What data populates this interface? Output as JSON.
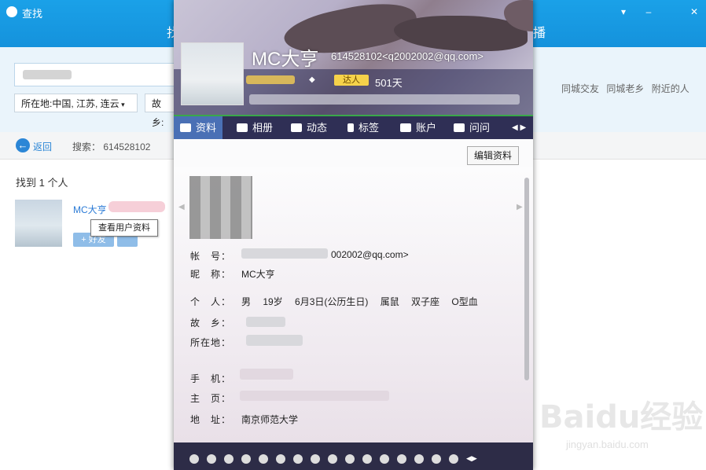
{
  "window": {
    "title": "查找",
    "header_partial": "找",
    "header_partial_right": "播"
  },
  "search": {
    "location_filter": "所在地:中国, 江苏, 连云",
    "hometown_filter": "故乡:"
  },
  "side_links": [
    "同城交友",
    "同城老乡",
    "附近的人"
  ],
  "nav": {
    "back_label": "返回",
    "search_label": "搜索：",
    "search_value": "614528102"
  },
  "results": {
    "count_label": "找到 1 个人",
    "items": [
      {
        "name": "MC大亨",
        "add_label": "+ 好友",
        "tooltip": "查看用户资料"
      }
    ]
  },
  "profile": {
    "name": "MC大亨",
    "qq_email": "614528102<q2002002@qq.com>",
    "badge": "达人",
    "days": "501天",
    "tabs": [
      "资料",
      "相册",
      "动态",
      "标签",
      "账户",
      "问问"
    ],
    "edit_button": "编辑资料",
    "fields": [
      {
        "label": "帐　号：",
        "value": "002002@qq.com>"
      },
      {
        "label": "昵　称：",
        "value": "MC大亨"
      },
      {
        "label": "个　人：",
        "value": "男　 19岁　 6月3日(公历生日)　 属鼠　 双子座　 O型血"
      },
      {
        "label": "故　乡：",
        "value": ""
      },
      {
        "label": "所在地：",
        "value": ""
      },
      {
        "label": "手　机：",
        "value": ""
      },
      {
        "label": "主　页：",
        "value": ""
      },
      {
        "label": "地　址：",
        "value": "南京师范大学"
      }
    ]
  },
  "watermark": {
    "brand": "Baidu经验",
    "url": "jingyan.baidu.com"
  },
  "colors": {
    "titlebar": "#1592dc",
    "link": "#2b7bd6",
    "tab_bar": "#2f2f55",
    "active_tab": "#4a70b5"
  }
}
